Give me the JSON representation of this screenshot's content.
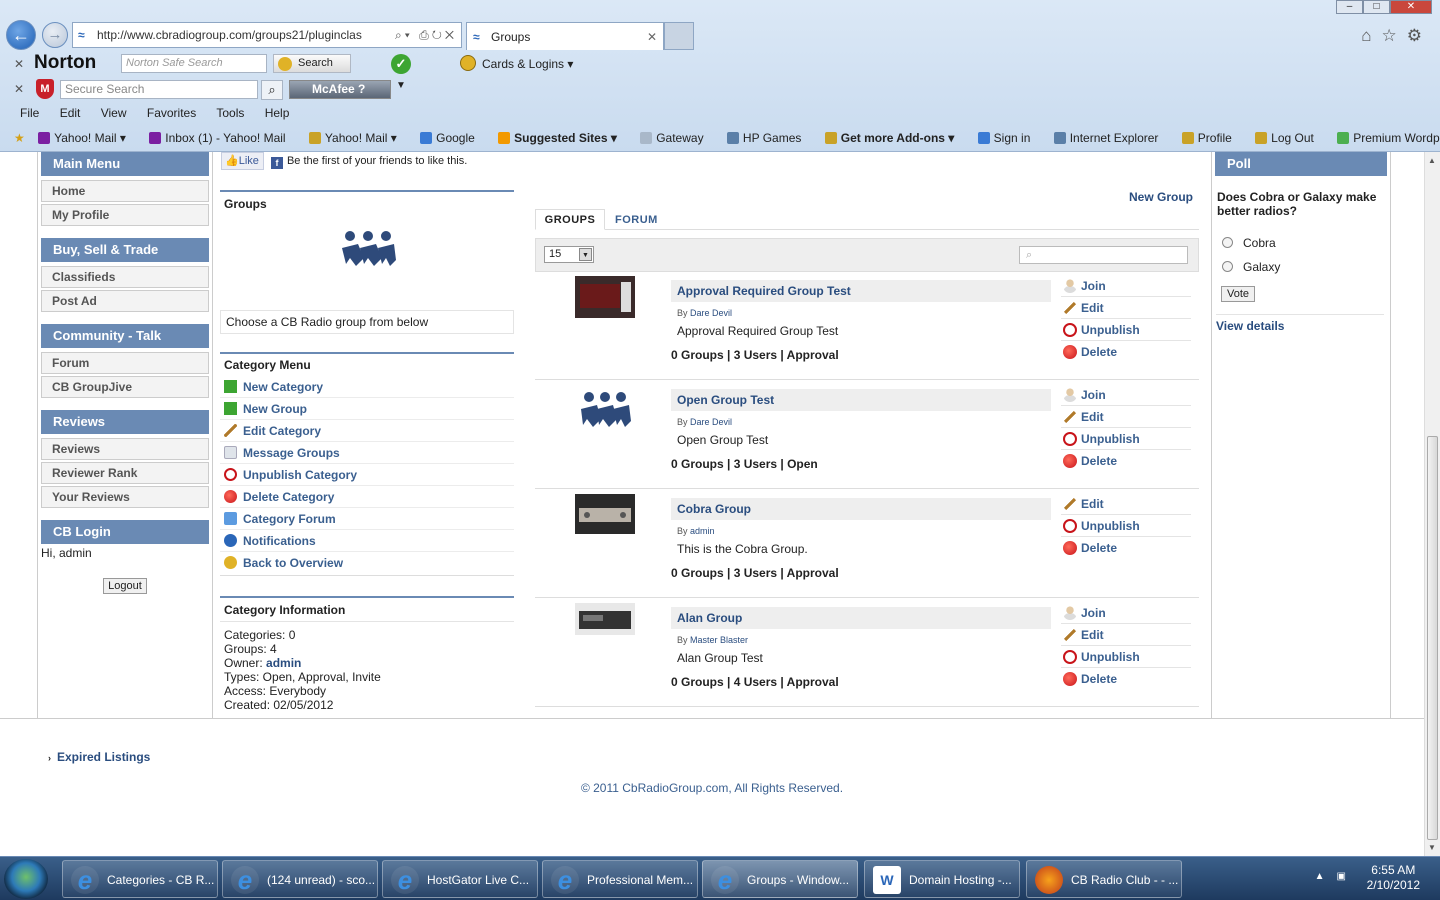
{
  "browser": {
    "url": "http://www.cbradiogroup.com/groups21/pluginclas",
    "tab_title": "Groups",
    "menu": [
      "File",
      "Edit",
      "View",
      "Favorites",
      "Tools",
      "Help"
    ],
    "favorites": [
      "Yahoo! Mail ▾",
      "Inbox (1) - Yahoo! Mail",
      "Yahoo! Mail ▾",
      "Google",
      "Suggested Sites ▾",
      "Gateway",
      "HP Games",
      "Get more Add-ons ▾",
      "Sign in",
      "Internet Explorer",
      "Profile",
      "Log Out",
      "Premium Wordpress The..."
    ]
  },
  "toolbars": {
    "norton_label": "Norton",
    "norton_placeholder": "Norton Safe Search",
    "search_button": "Search",
    "cards_label": "Cards & Logins",
    "secure_placeholder": "Secure Search",
    "mcafee_label": "McAfee"
  },
  "sidebar": {
    "main_menu": "Main Menu",
    "main_items": [
      "Home",
      "My Profile"
    ],
    "trade": "Buy, Sell & Trade",
    "trade_items": [
      "Classifieds",
      "Post Ad"
    ],
    "community": "Community - Talk",
    "community_items": [
      "Forum",
      "CB GroupJive"
    ],
    "reviews": "Reviews",
    "reviews_items": [
      "Reviews",
      "Reviewer Rank",
      "Your Reviews"
    ],
    "login": "CB Login",
    "greeting": "Hi, admin",
    "logout": "Logout"
  },
  "facebook": {
    "like": "Like",
    "text": "Be the first of your friends to like this."
  },
  "groups_box": {
    "title": "Groups",
    "subtitle": "Choose a CB Radio group from below"
  },
  "category_menu": {
    "title": "Category Menu",
    "items": [
      "New Category",
      "New Group",
      "Edit Category",
      "Message Groups",
      "Unpublish Category",
      "Delete Category",
      "Category Forum",
      "Notifications",
      "Back to Overview"
    ]
  },
  "category_info": {
    "title": "Category Information",
    "categories": "Categories: 0",
    "groups": "Groups: 4",
    "owner_label": "Owner: ",
    "owner": "admin",
    "types": "Types: Open, Approval, Invite",
    "access": "Access: Everybody",
    "created": "Created: 02/05/2012"
  },
  "main": {
    "new_group": "New Group",
    "tabs": [
      "GROUPS",
      "FORUM"
    ],
    "per_page": "15",
    "groups": [
      {
        "title": "Approval Required Group Test",
        "by_label": "By ",
        "author": "Dare Devil",
        "desc": "Approval Required Group Test",
        "stats": "0 Groups | 3 Users | Approval",
        "actions": [
          "Join",
          "Edit",
          "Unpublish",
          "Delete"
        ]
      },
      {
        "title": "Open Group Test",
        "by_label": "By ",
        "author": "Dare Devil",
        "desc": "Open Group Test",
        "stats": "0 Groups | 3 Users | Open",
        "actions": [
          "Join",
          "Edit",
          "Unpublish",
          "Delete"
        ]
      },
      {
        "title": "Cobra Group",
        "by_label": "By ",
        "author": "admin",
        "desc": "This is the Cobra Group.",
        "stats": "0 Groups | 3 Users | Approval",
        "actions": [
          "Edit",
          "Unpublish",
          "Delete"
        ]
      },
      {
        "title": "Alan Group",
        "by_label": "By ",
        "author": "Master Blaster",
        "desc": "Alan Group Test",
        "stats": "0 Groups | 4 Users | Approval",
        "actions": [
          "Join",
          "Edit",
          "Unpublish",
          "Delete"
        ]
      }
    ]
  },
  "poll": {
    "title": "Poll",
    "question": "Does Cobra or Galaxy make better radios?",
    "options": [
      "Cobra",
      "Galaxy"
    ],
    "vote": "Vote",
    "details": "View details"
  },
  "footer": {
    "expired": "Expired Listings",
    "copyright": "© 2011 CbRadioGroup.com, All Rights Reserved."
  },
  "taskbar": {
    "items": [
      "Categories - CB R...",
      "(124 unread) - sco...",
      "HostGator Live C...",
      "Professional Mem...",
      "Groups - Window...",
      "Domain Hosting -...",
      "CB Radio Club - - ..."
    ],
    "time": "6:55 AM",
    "date": "2/10/2012"
  }
}
